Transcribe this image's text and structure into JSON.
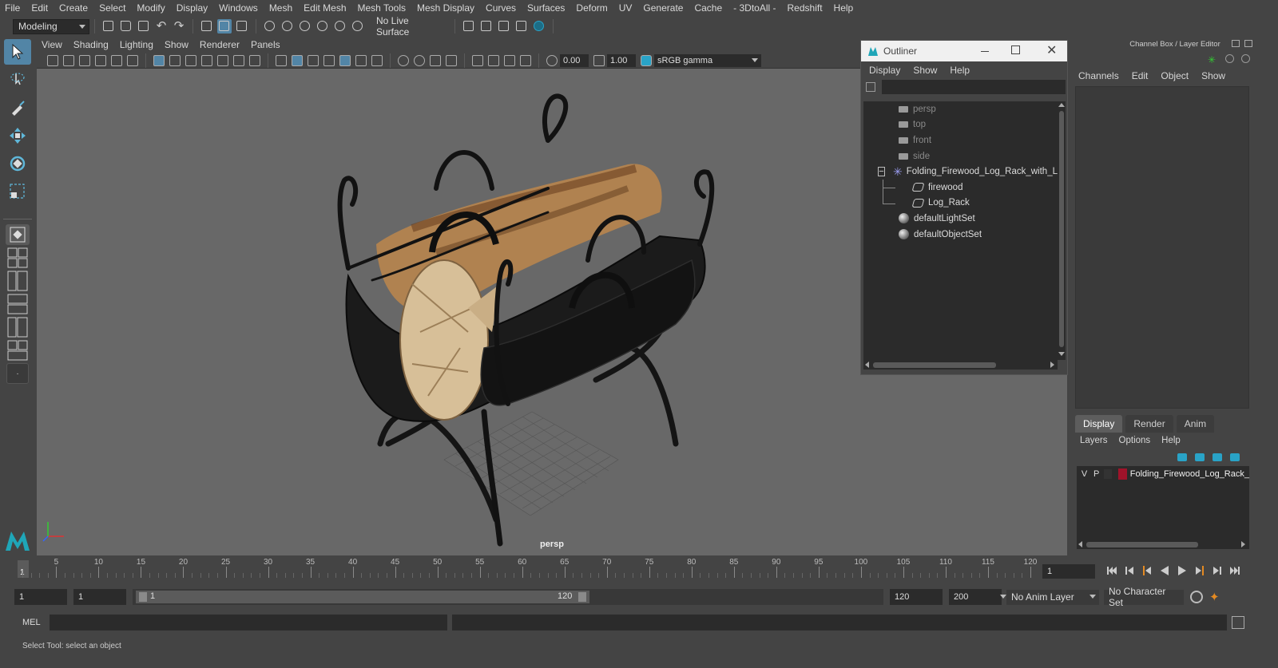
{
  "menubar": [
    "File",
    "Edit",
    "Create",
    "Select",
    "Modify",
    "Display",
    "Windows",
    "Mesh",
    "Edit Mesh",
    "Mesh Tools",
    "Mesh Display",
    "Curves",
    "Surfaces",
    "Deform",
    "UV",
    "Generate",
    "Cache",
    "- 3DtoAll -",
    "Redshift",
    "Help"
  ],
  "statusline": {
    "workspace": "Modeling",
    "live_surface": "No Live Surface"
  },
  "viewport": {
    "menu": [
      "View",
      "Shading",
      "Lighting",
      "Show",
      "Renderer",
      "Panels"
    ],
    "exposure": "0.00",
    "gamma": "1.00",
    "color_space": "sRGB gamma",
    "camera_label": "persp"
  },
  "outliner": {
    "title": "Outliner",
    "menu": [
      "Display",
      "Show",
      "Help"
    ],
    "items": [
      {
        "label": "persp",
        "type": "camera",
        "dim": true
      },
      {
        "label": "top",
        "type": "camera",
        "dim": true
      },
      {
        "label": "front",
        "type": "camera",
        "dim": true
      },
      {
        "label": "side",
        "type": "camera",
        "dim": true
      },
      {
        "label": "Folding_Firewood_Log_Rack_with_L",
        "type": "group"
      },
      {
        "label": "firewood",
        "type": "mesh"
      },
      {
        "label": "Log_Rack",
        "type": "mesh"
      },
      {
        "label": "defaultLightSet",
        "type": "set"
      },
      {
        "label": "defaultObjectSet",
        "type": "set"
      }
    ]
  },
  "channelbox": {
    "title": "Channel Box / Layer Editor",
    "menu": [
      "Channels",
      "Edit",
      "Object",
      "Show"
    ],
    "tabs": [
      "Display",
      "Render",
      "Anim"
    ],
    "layer_menu": [
      "Layers",
      "Options",
      "Help"
    ],
    "layer": {
      "v": "V",
      "p": "P",
      "name": "Folding_Firewood_Log_Rack_",
      "color": "#a0132a"
    }
  },
  "timeline": {
    "ticks": [
      "5",
      "10",
      "15",
      "20",
      "25",
      "30",
      "35",
      "40",
      "45",
      "50",
      "55",
      "60",
      "65",
      "70",
      "75",
      "80",
      "85",
      "90",
      "95",
      "100",
      "105",
      "110",
      "115",
      "120"
    ],
    "current_frame_marker": "1",
    "current_frame": "1"
  },
  "range": {
    "start": "1",
    "playback_start": "1",
    "range_start_label": "1",
    "range_end_label": "120",
    "playback_end": "120",
    "end": "200",
    "anim_layer": "No Anim Layer",
    "character_set": "No Character Set"
  },
  "cmdline": {
    "label": "MEL"
  },
  "helpline": {
    "text": "Select Tool: select an object"
  }
}
